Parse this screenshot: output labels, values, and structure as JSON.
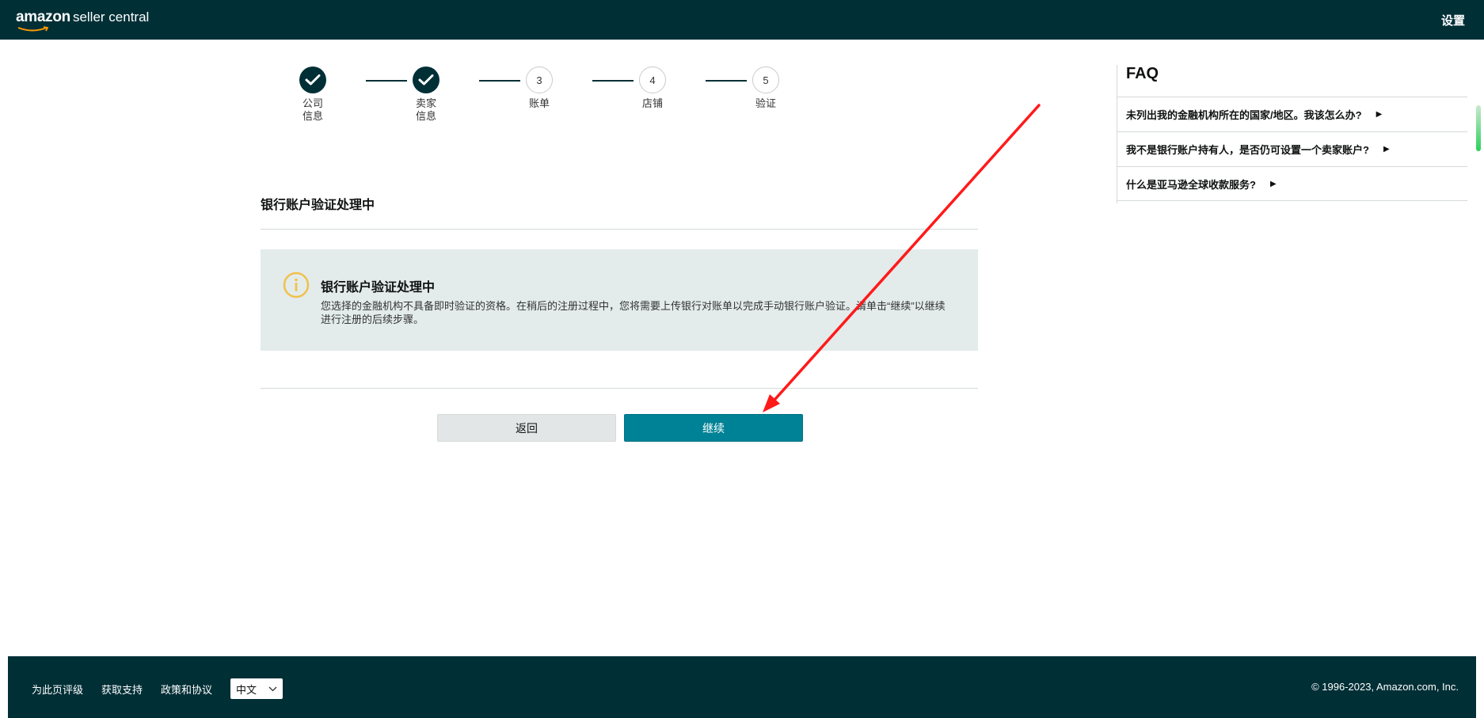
{
  "header": {
    "logo_brand": "amazon",
    "logo_rest": "seller central",
    "settings_label": "设置"
  },
  "stepper": {
    "steps": [
      {
        "label": "公司信息",
        "number": "1",
        "status": "done"
      },
      {
        "label": "卖家信息",
        "number": "2",
        "status": "done"
      },
      {
        "label": "账单",
        "number": "3",
        "status": "todo"
      },
      {
        "label": "店铺",
        "number": "4",
        "status": "todo"
      },
      {
        "label": "验证",
        "number": "5",
        "status": "todo"
      }
    ]
  },
  "main": {
    "section_title": "银行账户验证处理中",
    "alert": {
      "icon": "info-icon",
      "title": "银行账户验证处理中",
      "text": "您选择的金融机构不具备即时验证的资格。在稍后的注册过程中，您将需要上传银行对账单以完成手动银行账户验证。请单击“继续”以继续进行注册的后续步骤。"
    },
    "back_label": "返回",
    "continue_label": "继续"
  },
  "faq": {
    "title": "FAQ",
    "items": [
      {
        "label": "未列出我的金融机构所在的国家/地区。我该怎么办?"
      },
      {
        "label": "我不是银行账户持有人，是否仍可设置一个卖家账户?"
      },
      {
        "label": "什么是亚马逊全球收款服务?"
      }
    ]
  },
  "footer": {
    "links": [
      "为此页评级",
      "获取支持",
      "政策和协议"
    ],
    "language_selected": "中文",
    "copyright": "© 1996-2023, Amazon.com, Inc."
  },
  "colors": {
    "header_bg": "#002f36",
    "primary_button": "#008296",
    "alert_bg": "#e3ebeb",
    "info_icon": "#f0c14b",
    "annotation_arrow": "#ff1a1a"
  }
}
